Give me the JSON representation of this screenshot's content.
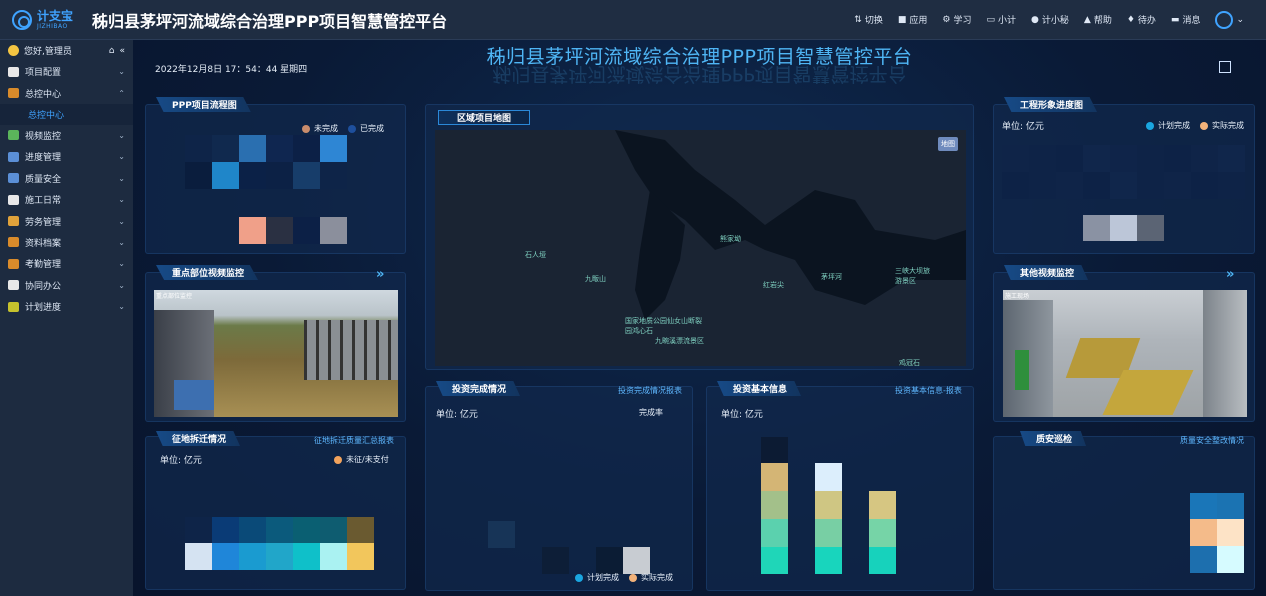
{
  "header": {
    "logo_cn": "计支宝",
    "logo_en": "JIZHIBAO",
    "title": "秭归县茅坪河流域综合治理PPP项目智慧管控平台",
    "actions": [
      {
        "icon": "switch-icon",
        "label": "切换"
      },
      {
        "icon": "apps-icon",
        "label": "应用"
      },
      {
        "icon": "learn-icon",
        "label": "学习"
      },
      {
        "icon": "calculator-icon",
        "label": "小计"
      },
      {
        "icon": "secretary-icon",
        "label": "计小秘"
      },
      {
        "icon": "help-icon",
        "label": "帮助"
      },
      {
        "icon": "bell-icon",
        "label": "待办"
      },
      {
        "icon": "message-icon",
        "label": "消息"
      }
    ]
  },
  "sidebar": {
    "greeting": "您好,管理员",
    "items": [
      {
        "label": "项目配置",
        "color": "#e8e8e8",
        "expanded": false
      },
      {
        "label": "总控中心",
        "color": "#d98b2b",
        "expanded": true,
        "sub": "总控中心"
      },
      {
        "label": "视频监控",
        "color": "#5bb55b",
        "expanded": false
      },
      {
        "label": "进度管理",
        "color": "#5b8fd6",
        "expanded": false
      },
      {
        "label": "质量安全",
        "color": "#5b8fd6",
        "expanded": false
      },
      {
        "label": "施工日常",
        "color": "#e8e8e8",
        "expanded": false
      },
      {
        "label": "劳务管理",
        "color": "#e0a23b",
        "expanded": false
      },
      {
        "label": "资料档案",
        "color": "#d98b2b",
        "expanded": false
      },
      {
        "label": "考勤管理",
        "color": "#d98b2b",
        "expanded": false
      },
      {
        "label": "协同办公",
        "color": "#e8e8e8",
        "expanded": false
      },
      {
        "label": "计划进度",
        "color": "#c6c22d",
        "expanded": false
      }
    ]
  },
  "dashboard": {
    "title": "秭归县茅坪河流域综合治理PPP项目智慧管控平台",
    "datetime": "2022年12月8日 17：54：44 星期四",
    "ppp_flow": {
      "title": "PPP项目流程图",
      "legend": [
        "未完成",
        "已完成"
      ],
      "legend_colors": [
        "#e0967a",
        "#1e4f9c"
      ]
    },
    "key_video": {
      "title": "重点部位视频监控",
      "tag": "重点部位监控"
    },
    "land": {
      "title": "征地拆迁情况",
      "link": "征地拆迁质量汇总报表",
      "unit": "单位: 亿元",
      "legend": "未征/未支付",
      "legend_color": "#f2a35c"
    },
    "map": {
      "title": "区域项目地图",
      "button": "地图",
      "labels": [
        "石人垭",
        "熊家坳",
        "九畈山",
        "红岩尖",
        "茅坪河",
        "三峡大坝旅游景区",
        "国家地质公园仙女山断裂园鸿心石",
        "九畹溪漂流景区",
        "鸡冠石"
      ]
    },
    "invest_done": {
      "title": "投资完成情况",
      "link": "投资完成情况报表",
      "unit": "单位: 亿元",
      "rate_label": "完成率"
    },
    "invest_info": {
      "title": "投资基本信息",
      "link": "投资基本信息-报表",
      "unit": "单位: 亿元"
    },
    "progress": {
      "title": "工程形象进度图",
      "unit": "单位: 亿元",
      "legend": [
        "计划完成",
        "实际完成"
      ],
      "legend_colors": [
        "#1aa6e0",
        "#f2b27a"
      ]
    },
    "other_video": {
      "title": "其他视频监控",
      "tag": "施工现场"
    },
    "quality": {
      "title": "质安巡检",
      "link": "质量安全整改情况"
    },
    "bottom_legend": [
      "计划完成",
      "实际完成"
    ]
  }
}
